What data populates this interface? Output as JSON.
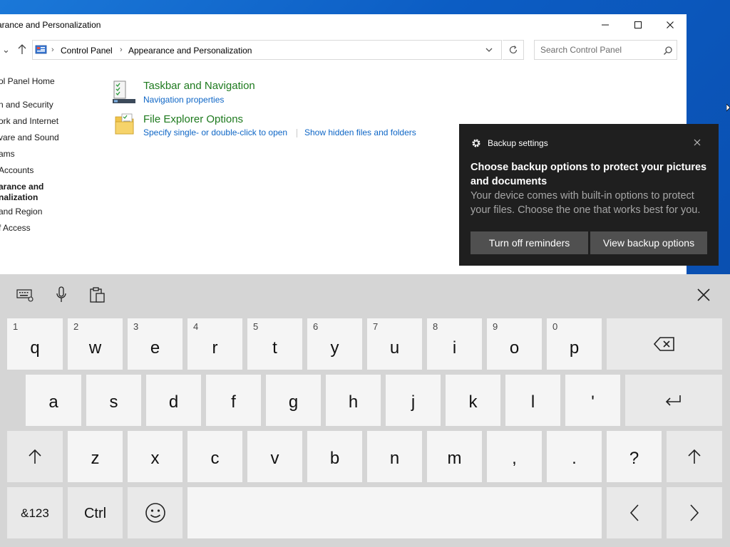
{
  "window": {
    "title": "arance and Personalization",
    "minimize_icon": "minimize-icon",
    "maximize_icon": "maximize-icon",
    "close_icon": "close-icon"
  },
  "address": {
    "crumbs": [
      "Control Panel",
      "Appearance and Personalization"
    ],
    "search_placeholder": "Search Control Panel"
  },
  "sidebar": {
    "items": [
      {
        "label": "ol Panel Home"
      },
      {
        "label": "n and Security"
      },
      {
        "label": "ork and Internet"
      },
      {
        "label": "vare and Sound"
      },
      {
        "label": "ams"
      },
      {
        "label": "Accounts"
      },
      {
        "label": "arance and",
        "label2": "nalization",
        "active": true
      },
      {
        "label": " and Region"
      },
      {
        "label": "f Access"
      }
    ]
  },
  "tasks": [
    {
      "title": "Taskbar and Navigation",
      "links": [
        "Navigation properties"
      ],
      "icon": "taskbar-icon"
    },
    {
      "title": "File Explorer Options",
      "links": [
        "Specify single- or double-click to open",
        "Show hidden files and folders"
      ],
      "icon": "folder-options-icon"
    }
  ],
  "toast": {
    "app_name": "Backup settings",
    "heading": "Choose backup options to protect your pictures and documents",
    "body": "Your device comes with built-in options to protect your files. Choose the one that works best for you.",
    "buttons": [
      "Turn off reminders",
      "View backup options"
    ]
  },
  "keyboard": {
    "toolbar": [
      "keyboard-settings-icon",
      "microphone-icon",
      "clipboard-icon",
      "close-keyboard-icon"
    ],
    "row1": [
      {
        "num": "1",
        "char": "q"
      },
      {
        "num": "2",
        "char": "w"
      },
      {
        "num": "3",
        "char": "e"
      },
      {
        "num": "4",
        "char": "r"
      },
      {
        "num": "5",
        "char": "t"
      },
      {
        "num": "6",
        "char": "y"
      },
      {
        "num": "7",
        "char": "u"
      },
      {
        "num": "8",
        "char": "i"
      },
      {
        "num": "9",
        "char": "o"
      },
      {
        "num": "0",
        "char": "p"
      }
    ],
    "row2": [
      "a",
      "s",
      "d",
      "f",
      "g",
      "h",
      "j",
      "k",
      "l",
      "'"
    ],
    "row3": [
      "z",
      "x",
      "c",
      "v",
      "b",
      "n",
      "m",
      ",",
      ".",
      "?"
    ],
    "symbols_label": "&123",
    "ctrl_label": "Ctrl"
  }
}
